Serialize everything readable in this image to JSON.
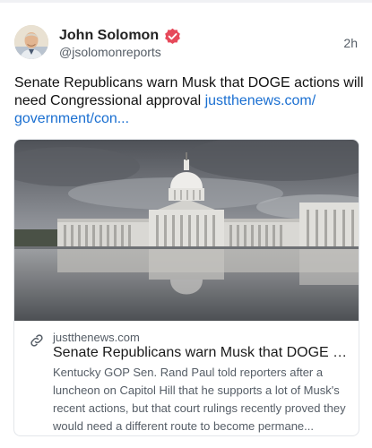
{
  "post": {
    "author_name": "John Solomon",
    "author_handle": "@jsolomonreports",
    "timestamp": "2h",
    "text": "Senate Republicans warn Musk that DOGE actions will need Congressional approval ",
    "link_text": "justthenews.com/​government/con...",
    "verified_badge_color": "#e6495a",
    "link_color": "#1a6fd1"
  },
  "link_card": {
    "domain": "justthenews.com",
    "title": "Senate Republicans warn Musk that DOGE acti...",
    "description": "Kentucky GOP Sen. Rand Paul told reporters after a luncheon on Capitol Hill that he supports a lot of Musk's recent actions, but that court rulings recently proved they would need a different route to become permane...",
    "image_subject": "US Capitol building reflected in water",
    "icon": "link-icon"
  }
}
